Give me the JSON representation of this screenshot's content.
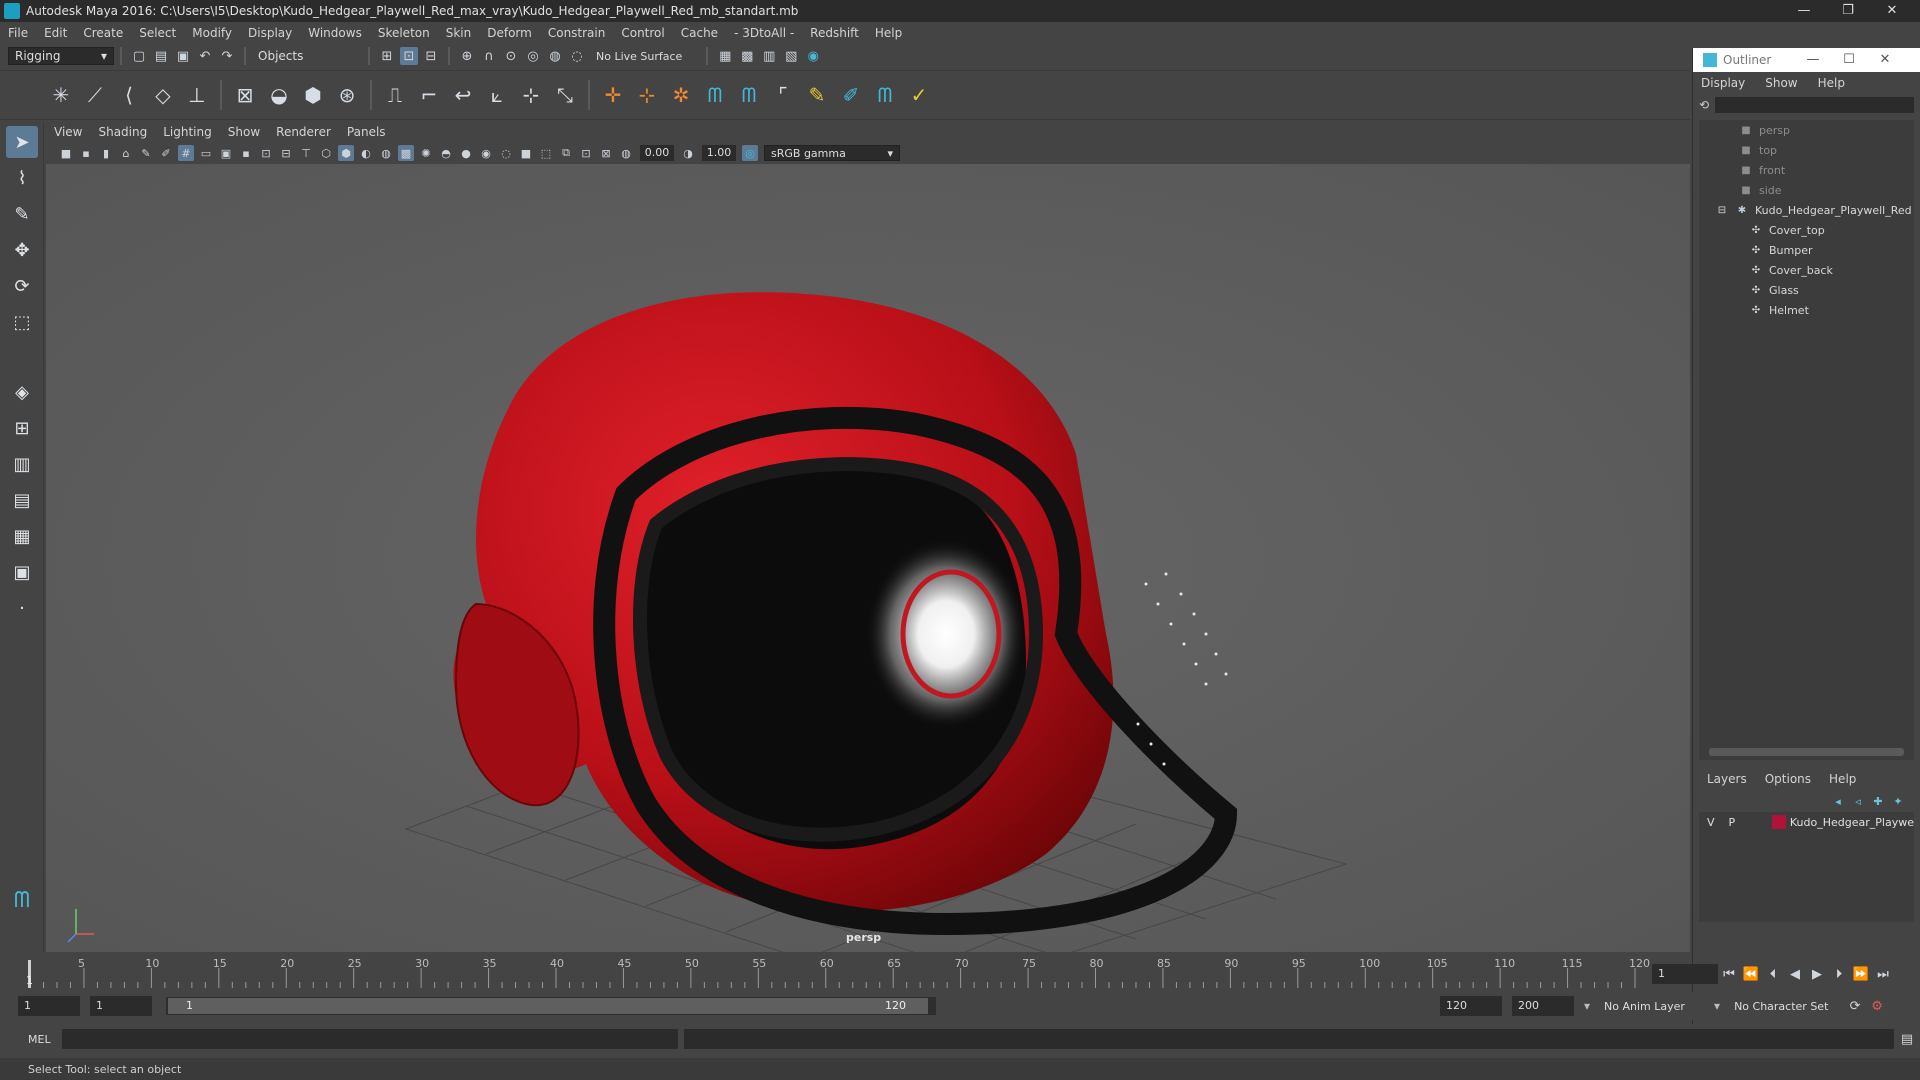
{
  "window": {
    "title": "Autodesk Maya 2016: C:\\Users\\I5\\Desktop\\Kudo_Hedgear_Playwell_Red_max_vray\\Kudo_Hedgear_Playwell_Red_mb_standart.mb"
  },
  "menubar": {
    "items": [
      "File",
      "Edit",
      "Create",
      "Select",
      "Modify",
      "Display",
      "Windows",
      "Skeleton",
      "Skin",
      "Deform",
      "Constrain",
      "Control",
      "Cache",
      "- 3DtoAll -",
      "Redshift",
      "Help"
    ]
  },
  "statusline": {
    "menuset": "Rigging",
    "selection_mode": "Objects",
    "live_surface": "No Live Surface"
  },
  "panel": {
    "menu": [
      "View",
      "Shading",
      "Lighting",
      "Show",
      "Renderer",
      "Panels"
    ],
    "exposure": "0.00",
    "gamma": "1.00",
    "color_space": "sRGB gamma",
    "camera": "persp"
  },
  "outliner": {
    "title": "Outliner",
    "menu": [
      "Display",
      "Show",
      "Help"
    ],
    "cameras": [
      "persp",
      "top",
      "front",
      "side"
    ],
    "group": "Kudo_Hedgear_Playwell_Red",
    "children": [
      "Cover_top",
      "Bumper",
      "Cover_back",
      "Glass",
      "Helmet"
    ]
  },
  "layers": {
    "menu": [
      "Layers",
      "Options",
      "Help"
    ],
    "row": {
      "v": "V",
      "p": "P",
      "name": "Kudo_Hedgear_Playwe",
      "color": "#b0123a"
    }
  },
  "timeline": {
    "ticks": [
      "5",
      "10",
      "15",
      "20",
      "25",
      "30",
      "35",
      "40",
      "45",
      "50",
      "55",
      "60",
      "65",
      "70",
      "75",
      "80",
      "85",
      "90",
      "95",
      "100",
      "105",
      "110",
      "115",
      "120"
    ],
    "current_frame": "1",
    "current_marker": "1"
  },
  "range": {
    "start": "1",
    "playback_start": "1",
    "range_start_label": "1",
    "range_end_label": "120",
    "playback_end": "120",
    "end": "200",
    "anim_layer": "No Anim Layer",
    "character_set": "No Character Set"
  },
  "cmdline": {
    "label": "MEL"
  },
  "helpline": {
    "text": "Select Tool: select an object"
  }
}
